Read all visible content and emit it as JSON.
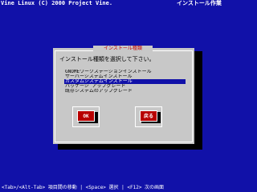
{
  "header": {
    "left": "Vine Linux (C) 2000 Project Vine.",
    "right": "インストール作業"
  },
  "dialog": {
    "title": "インストール種類",
    "prompt": "インストール種類を選択して下さい。",
    "options": [
      "GNOMEワークステーションインストール",
      "サーバーシステムインストール",
      "カスタムシステムインストール",
      "パッケージ アップグレード",
      "既存システムのアップグレード"
    ],
    "selected_index": 2,
    "ok_label": "OK",
    "back_label": "戻る"
  },
  "footer": {
    "hint": "<Tab>/<Alt-Tab> 項目間の移動 | <Space> 選択 | <F12> 次の画面"
  },
  "colors": {
    "background": "#1111a8",
    "dialog": "#c8c8c8",
    "button": "#b80000",
    "title_text": "#c00000"
  }
}
